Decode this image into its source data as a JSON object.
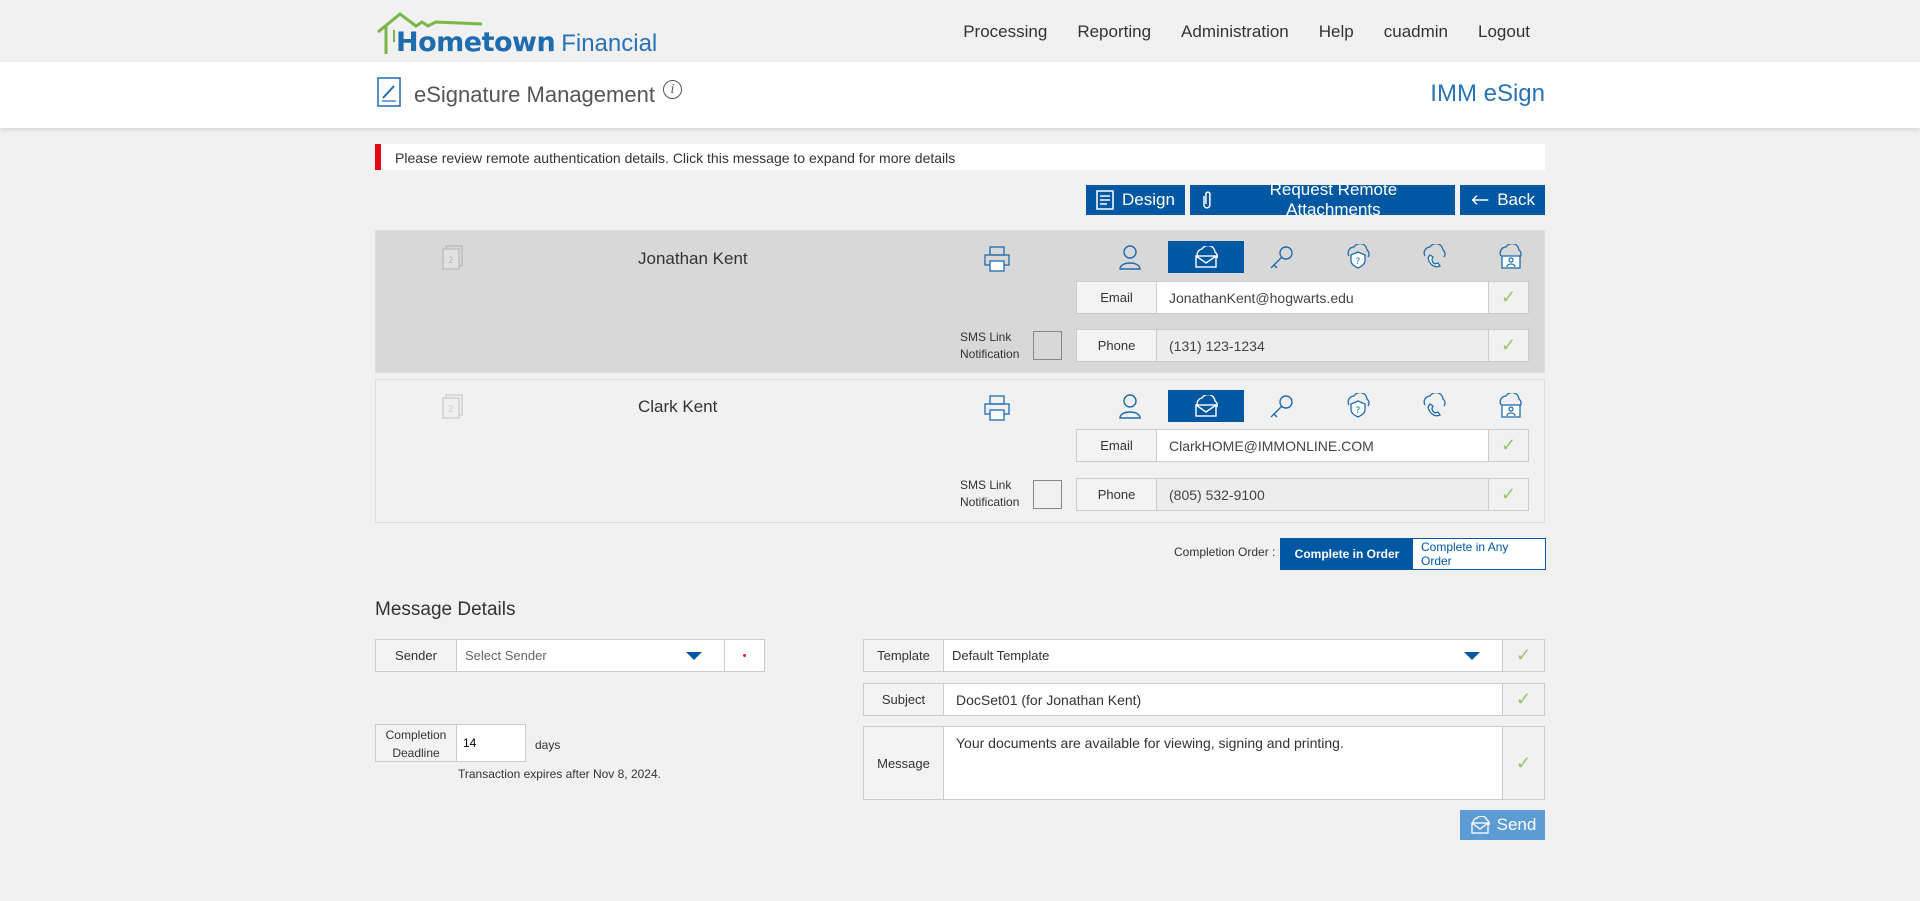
{
  "brand": {
    "primary": "Hometown",
    "secondary": "Financial"
  },
  "nav": [
    "Processing",
    "Reporting",
    "Administration",
    "Help",
    "cuadmin",
    "Logout"
  ],
  "subheader": {
    "title": "eSignature Management",
    "right_brand": "IMM eSign"
  },
  "alert": "Please review remote authentication details. Click this message to expand for more details",
  "actions": {
    "design": "Design",
    "request_attachments": "Request Remote Attachments",
    "back": "Back"
  },
  "signers": [
    {
      "name": "Jonathan Kent",
      "email_label": "Email",
      "email": "JonathanKent@hogwarts.edu",
      "phone_label": "Phone",
      "phone": "(131) 123-1234",
      "sms_label_1": "SMS Link",
      "sms_label_2": "Notification",
      "active_auth": "email"
    },
    {
      "name": "Clark Kent",
      "email_label": "Email",
      "email": "ClarkHOME@IMMONLINE.COM",
      "phone_label": "Phone",
      "phone": "(805) 532-9100",
      "sms_label_1": "SMS Link",
      "sms_label_2": "Notification",
      "active_auth": "email"
    }
  ],
  "check_glyph": "✓",
  "completion": {
    "label": "Completion Order :",
    "in_order": "Complete in Order",
    "any_order": "Complete in Any Order",
    "selected": "Complete in Order"
  },
  "message_details": {
    "title": "Message Details",
    "sender_label": "Sender",
    "sender_placeholder": "Select Sender",
    "required_mark": "•",
    "template_label": "Template",
    "template_value": "Default Template",
    "subject_label": "Subject",
    "subject_value": "DocSet01 (for Jonathan Kent)",
    "message_label": "Message",
    "message_value": "Your documents are available for viewing, signing and printing.",
    "deadline_label_1": "Completion",
    "deadline_label_2": "Deadline",
    "deadline_value": "14",
    "days": "days",
    "expires": "Transaction expires after Nov 8, 2024.",
    "send": "Send"
  },
  "colors": {
    "accent": "#0058a3",
    "alert": "#e30613",
    "check": "#9bc36b",
    "send": "#5d9bd4"
  }
}
